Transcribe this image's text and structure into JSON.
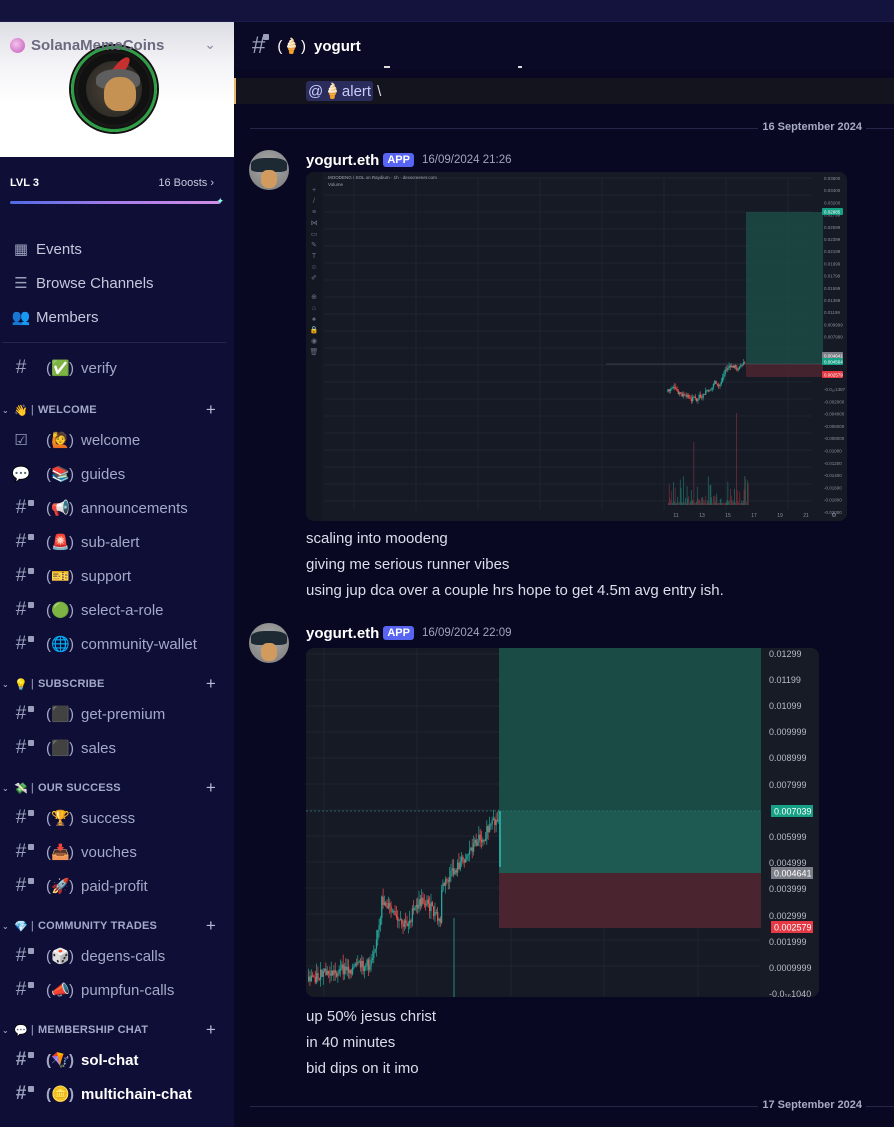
{
  "server": {
    "name": "SolanaMemeCoins",
    "level": "LVL 3",
    "boosts": "16 Boosts",
    "boost_progress": 1.0
  },
  "nav": [
    {
      "label": "Events",
      "icon": "calendar-icon",
      "glyph": "▦"
    },
    {
      "label": "Browse Channels",
      "icon": "browse-channels-icon",
      "glyph": "☰"
    },
    {
      "label": "Members",
      "icon": "members-icon",
      "glyph": "👥"
    }
  ],
  "top_channel": {
    "emoji": "✅",
    "name": "verify"
  },
  "categories": [
    {
      "emoji": "👋",
      "name": "WELCOME",
      "channels": [
        {
          "emoji": "🙋",
          "name": "welcome",
          "type": "rules"
        },
        {
          "emoji": "📚",
          "name": "guides",
          "type": "forum"
        },
        {
          "emoji": "📢",
          "name": "announcements",
          "type": "locked"
        },
        {
          "emoji": "🚨",
          "name": "sub-alert",
          "type": "locked"
        },
        {
          "emoji": "🎫",
          "name": "support",
          "type": "locked"
        },
        {
          "emoji": "🟢",
          "name": "select-a-role",
          "type": "locked"
        },
        {
          "emoji": "🌐",
          "name": "community-wallet",
          "type": "locked"
        }
      ]
    },
    {
      "emoji": "💡",
      "name": "SUBSCRIBE",
      "channels": [
        {
          "emoji": "⬛",
          "name": "get-premium",
          "type": "locked"
        },
        {
          "emoji": "⬛",
          "name": "sales",
          "type": "locked"
        }
      ]
    },
    {
      "emoji": "💸",
      "name": "OUR SUCCESS",
      "channels": [
        {
          "emoji": "🏆",
          "name": "success",
          "type": "locked"
        },
        {
          "emoji": "📥",
          "name": "vouches",
          "type": "locked"
        },
        {
          "emoji": "🚀",
          "name": "paid-profit",
          "type": "locked"
        }
      ]
    },
    {
      "emoji": "💎",
      "name": "COMMUNITY TRADES",
      "channels": [
        {
          "emoji": "🎲",
          "name": "degens-calls",
          "type": "locked"
        },
        {
          "emoji": "📣",
          "name": "pumpfun-calls",
          "type": "locked"
        }
      ]
    },
    {
      "emoji": "💬",
      "name": "MEMBERSHIP CHAT",
      "channels": [
        {
          "emoji": "🪁",
          "name": "sol-chat",
          "type": "locked",
          "active": true
        },
        {
          "emoji": "🪙",
          "name": "multichain-chat",
          "type": "locked",
          "active": true
        }
      ]
    }
  ],
  "channel_header": {
    "emoji": "🍦",
    "name": "yogurt"
  },
  "prev_message": {
    "mention": "@🍦alert",
    "tail": "\\"
  },
  "date_separators": [
    "16 September 2024",
    "17 September 2024"
  ],
  "messages": [
    {
      "author": "yogurt.eth",
      "badge": "APP",
      "timestamp": "16/09/2024 21:26",
      "lines": [
        "scaling into moodeng",
        "giving me serious runner vibes",
        "using jup dca over a couple hrs hope to get 4.5m avg entry ish."
      ]
    },
    {
      "author": "yogurt.eth",
      "badge": "APP",
      "timestamp": "16/09/2024 22:09",
      "lines": [
        "up 50% jesus christ",
        "in 40 minutes",
        "bid dips on it imo"
      ]
    }
  ],
  "chart_data": [
    {
      "type": "candlestick",
      "title": "MOODENG / SOL on Raydium · 1h · dexscreener.com",
      "volume_label": "Volume",
      "y_ticks": [
        "0.03600",
        "0.03400",
        "0.03200",
        "0.02799",
        "0.02599",
        "0.02399",
        "0.02199",
        "0.01999",
        "0.01799",
        "0.01599",
        "0.01399",
        "0.01199",
        "0.009999",
        "0.007999"
      ],
      "price_labels": [
        {
          "value": "0.02985",
          "color": "#16a085"
        },
        {
          "value": "0.004641",
          "color": "#7c7f88"
        },
        {
          "value": "0.004564",
          "color": "#16a085"
        },
        {
          "value": "0.002579",
          "color": "#e53945"
        }
      ],
      "x_ticks": [
        "11",
        "13",
        "15",
        "17",
        "19",
        "21"
      ],
      "ylim": [
        -0.02,
        0.036
      ],
      "position": {
        "entry": 0.004641,
        "target": 0.02985,
        "stop": 0.002579
      }
    },
    {
      "type": "candlestick",
      "y_ticks": [
        "0.01299",
        "0.01199",
        "0.01099",
        "0.009999",
        "0.008999",
        "0.007999",
        "0.005999",
        "0.004999",
        "0.003999",
        "0.002999",
        "0.001999",
        "0.0009999",
        "-0.0₁₆1040"
      ],
      "price_labels": [
        {
          "value": "0.007039",
          "color": "#16a085"
        },
        {
          "value": "0.004641",
          "color": "#7c7f88"
        },
        {
          "value": "0.002579",
          "color": "#e53945"
        }
      ],
      "ylim": [
        0.0,
        0.0133
      ],
      "position": {
        "entry": 0.004641,
        "target": 0.0133,
        "stop": 0.002579,
        "last": 0.007039
      }
    }
  ]
}
